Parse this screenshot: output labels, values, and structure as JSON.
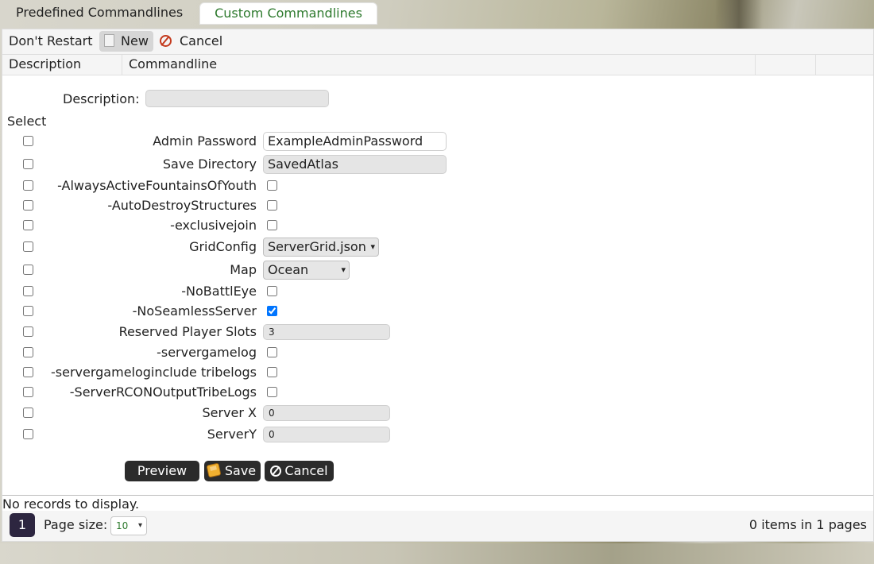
{
  "tabs": {
    "predefined": "Predefined Commandlines",
    "custom": "Custom Commandlines"
  },
  "toolbar": {
    "dont_restart": "Don't Restart",
    "new": "New",
    "cancel": "Cancel"
  },
  "grid_header": {
    "description": "Description",
    "commandline": "Commandline"
  },
  "form": {
    "description_label": "Description:",
    "description_value": "",
    "select_label": "Select",
    "rows": [
      {
        "label": "Admin Password",
        "value": "ExampleAdminPassword"
      },
      {
        "label": "Save Directory",
        "value": "SavedAtlas"
      },
      {
        "label": "-AlwaysActiveFountainsOfYouth",
        "checked": false
      },
      {
        "label": "-AutoDestroyStructures",
        "checked": false
      },
      {
        "label": "-exclusivejoin",
        "checked": false
      },
      {
        "label": "GridConfig",
        "value": "ServerGrid.json"
      },
      {
        "label": "Map",
        "value": "Ocean"
      },
      {
        "label": "-NoBattlEye",
        "checked": false
      },
      {
        "label": "-NoSeamlessServer",
        "checked": true
      },
      {
        "label": "Reserved Player Slots",
        "value": "3"
      },
      {
        "label": "-servergamelog",
        "checked": false
      },
      {
        "label": "-servergameloginclude tribelogs",
        "checked": false
      },
      {
        "label": "-ServerRCONOutputTribeLogs",
        "checked": false
      },
      {
        "label": "Server X",
        "value": "0"
      },
      {
        "label": "ServerY",
        "value": "0"
      }
    ]
  },
  "buttons": {
    "preview": "Preview",
    "save": "Save",
    "cancel": "Cancel"
  },
  "grid": {
    "no_records": "No records to display."
  },
  "pager": {
    "current_page": "1",
    "page_size_label": "Page size:",
    "page_size": "10",
    "items_info": "0 items in 1 pages"
  }
}
